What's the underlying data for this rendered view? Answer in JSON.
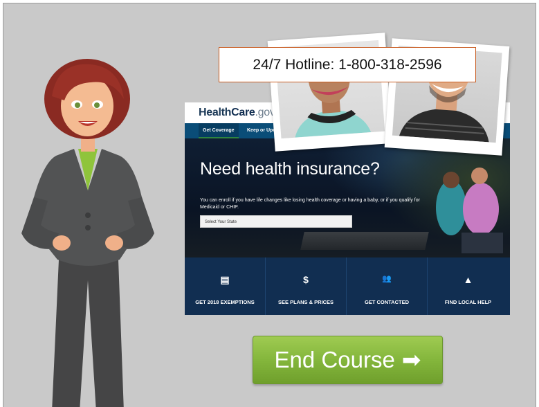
{
  "hotline": {
    "text": "24/7 Hotline: 1-800-318-2596"
  },
  "healthcare": {
    "logo": {
      "health": "Health",
      "care": "Care",
      "gov": ".gov"
    },
    "nav": [
      {
        "label": "Get Coverage"
      },
      {
        "label": "Keep or Upda"
      }
    ],
    "heading": "Need health insurance?",
    "subtext": "You can enroll if you have life changes like losing health coverage or having a baby, or if you qualify for Medicaid or CHIP.",
    "select_placeholder": "Select Your State",
    "tiles": [
      {
        "icon": "calculator-icon",
        "glyph": "▤",
        "label": "GET 2018 EXEMPTIONS"
      },
      {
        "icon": "dollar-icon",
        "glyph": "$",
        "label": "SEE PLANS & PRICES"
      },
      {
        "icon": "people-icon",
        "glyph": "👥",
        "label": "GET CONTACTED"
      },
      {
        "icon": "road-icon",
        "glyph": "▲",
        "label": "FIND LOCAL HELP"
      }
    ]
  },
  "end_course": {
    "label": "End Course",
    "arrow": "➡"
  },
  "colors": {
    "slide_bg": "#c9c9c9",
    "button_green": "#84b63c",
    "navy": "#112e51",
    "hotline_border": "#c85a1e"
  }
}
